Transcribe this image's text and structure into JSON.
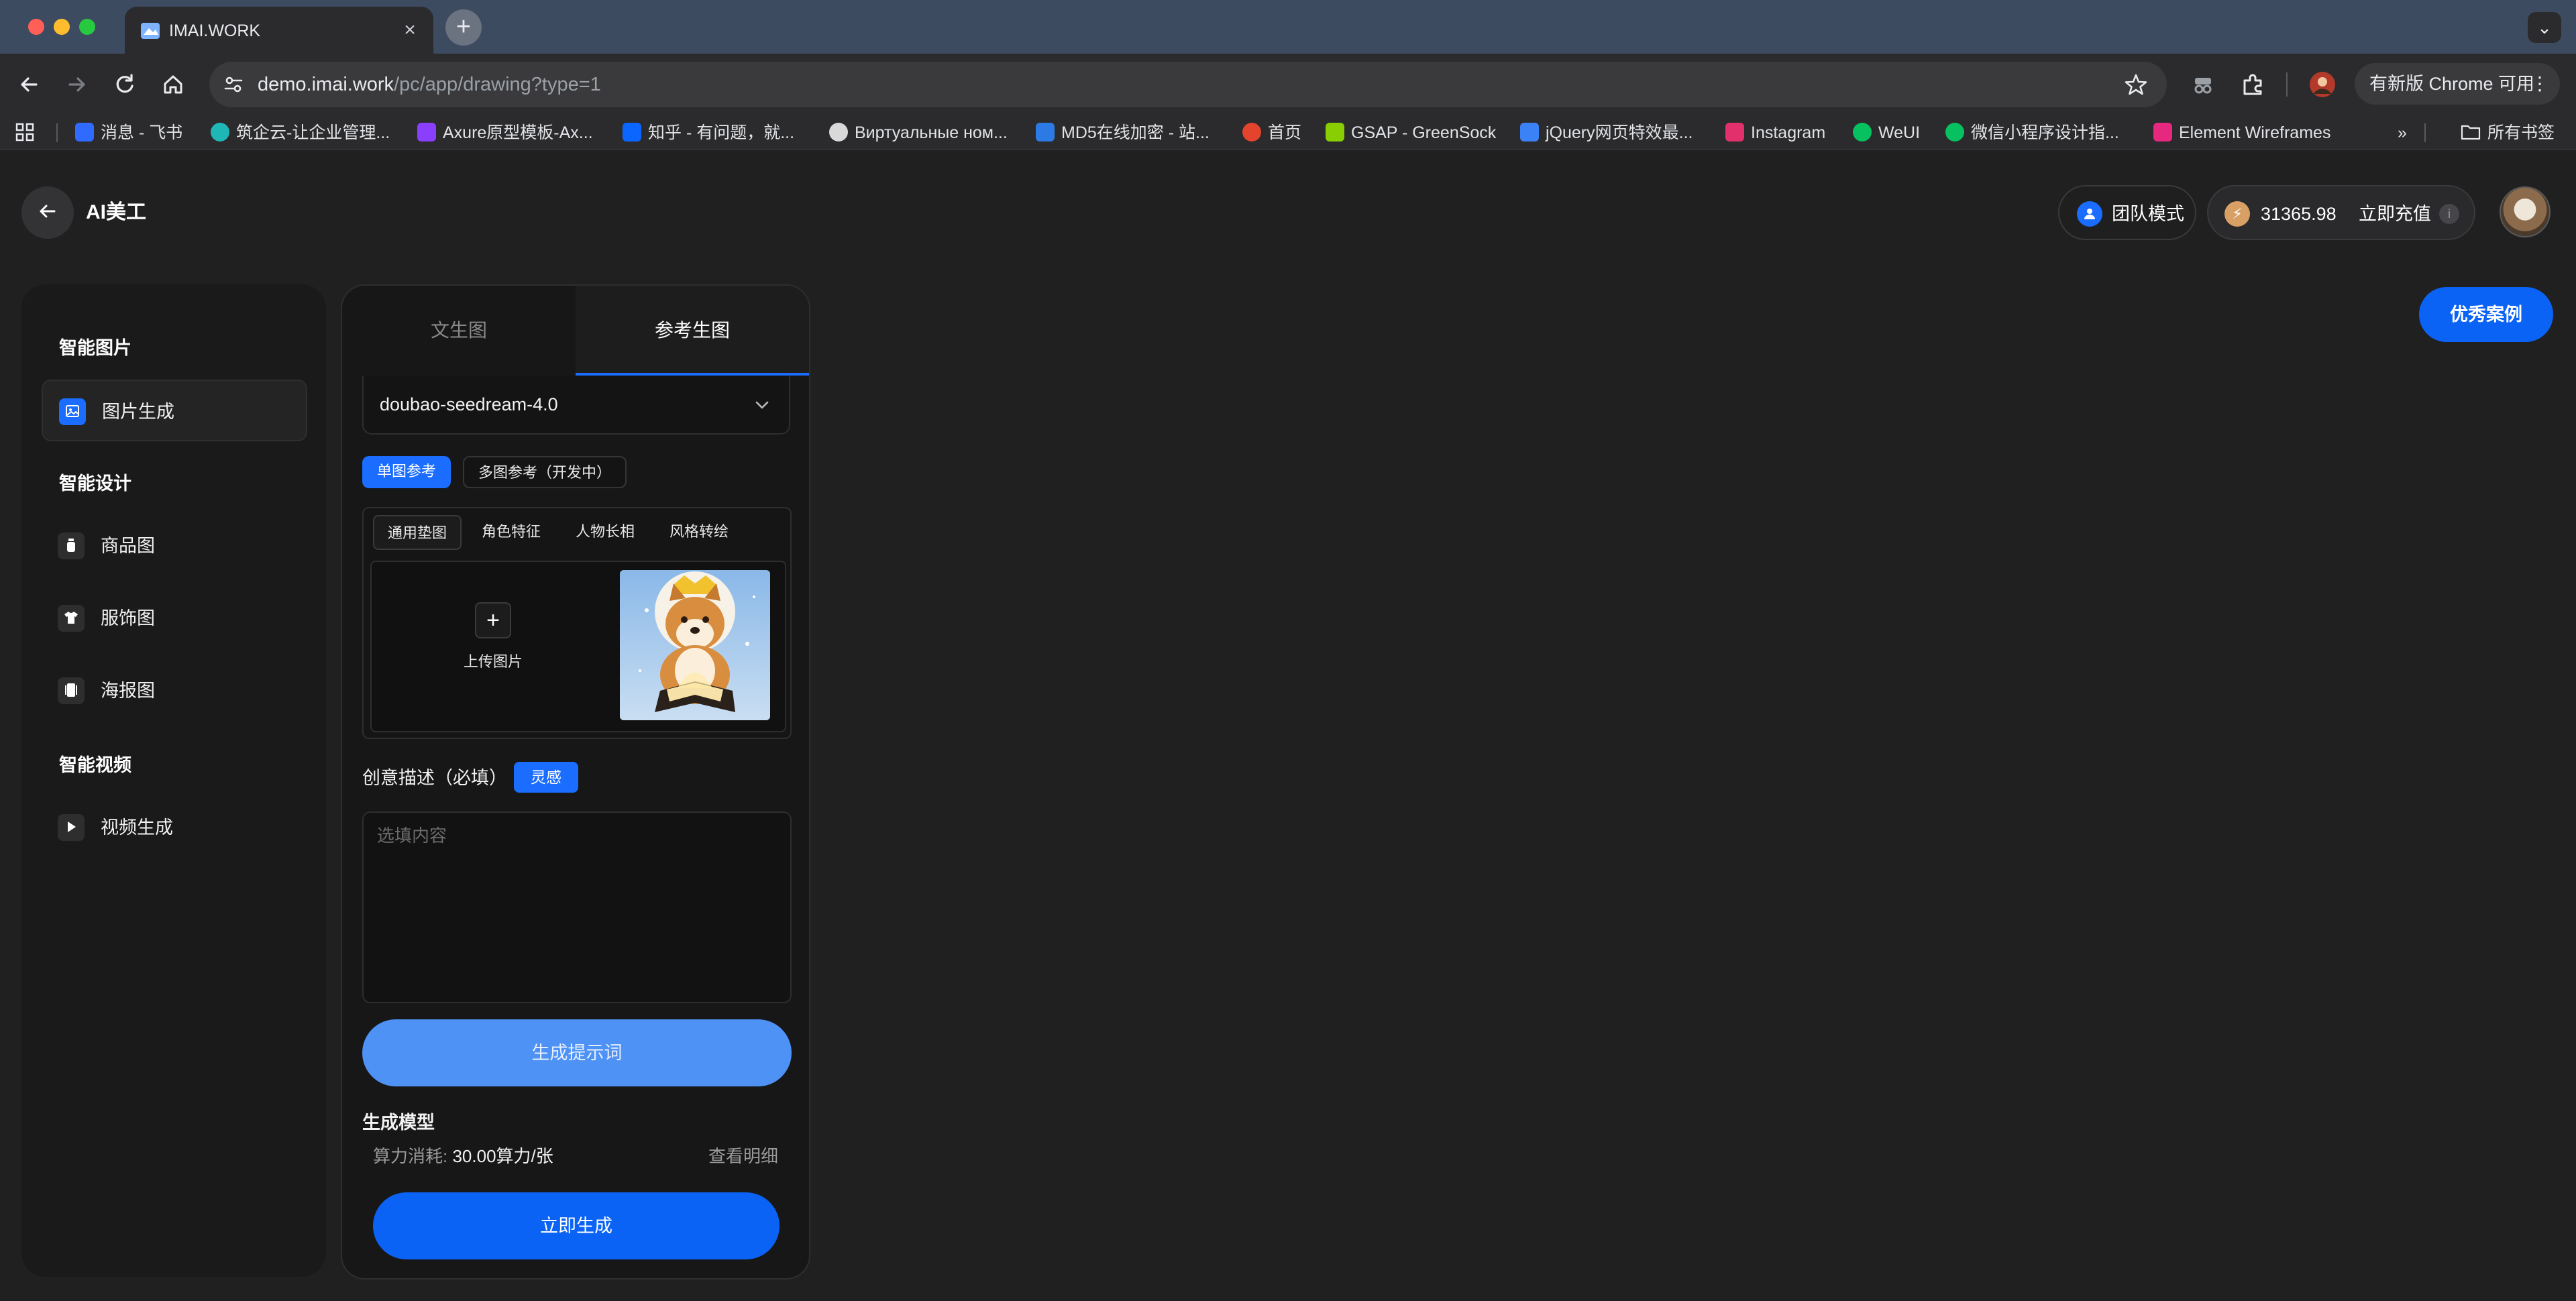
{
  "browser": {
    "tab_title": "IMAI.WORK",
    "url_host": "demo.imai.work",
    "url_path": "/pc/app/drawing?type=1",
    "update_label": "有新版 Chrome 可用",
    "bookmarks": [
      {
        "label": "消息 - 飞书",
        "color": "#2f6bff"
      },
      {
        "label": "筑企云-让企业管理...",
        "color": "#1fb6b6"
      },
      {
        "label": "Axure原型模板-Ax...",
        "color": "#8a3ffc"
      },
      {
        "label": "知乎 - 有问题，就...",
        "color": "#0a66ff"
      },
      {
        "label": "Виртуальные ном...",
        "color": "#d9d9d9"
      },
      {
        "label": "MD5在线加密 - 站...",
        "color": "#2c7be5"
      },
      {
        "label": "首页",
        "color": "#e4442d"
      },
      {
        "label": "GSAP - GreenSock",
        "color": "#88ce02"
      },
      {
        "label": "jQuery网页特效最...",
        "color": "#3b82f6"
      },
      {
        "label": "Instagram",
        "color": "#e1306c"
      },
      {
        "label": "WeUI",
        "color": "#07c160"
      },
      {
        "label": "微信小程序设计指...",
        "color": "#07c160"
      },
      {
        "label": "Element Wireframes",
        "color": "#e6287f"
      }
    ],
    "all_bookmarks_label": "所有书签"
  },
  "header": {
    "title": "AI美工",
    "team_mode_label": "团队模式",
    "balance": "31365.98",
    "recharge_label": "立即充值",
    "info_glyph": "i"
  },
  "sidebar": {
    "groups": [
      {
        "title": "智能图片",
        "items": [
          {
            "label": "图片生成",
            "icon": "image-icon",
            "active": true
          }
        ]
      },
      {
        "title": "智能设计",
        "items": [
          {
            "label": "商品图",
            "icon": "product-icon",
            "active": false
          },
          {
            "label": "服饰图",
            "icon": "shirt-icon",
            "active": false
          },
          {
            "label": "海报图",
            "icon": "poster-icon",
            "active": false
          }
        ]
      },
      {
        "title": "智能视频",
        "items": [
          {
            "label": "视频生成",
            "icon": "play-icon",
            "active": false
          }
        ]
      }
    ]
  },
  "panel": {
    "tabs": [
      {
        "label": "文生图",
        "active": false
      },
      {
        "label": "参考生图",
        "active": true
      }
    ],
    "model_value": "doubao-seedream-4.0",
    "ref_modes": [
      {
        "label": "单图参考",
        "active": true
      },
      {
        "label": "多图参考（开发中）",
        "active": false
      }
    ],
    "sub_tabs": [
      {
        "label": "通用垫图",
        "active": true
      },
      {
        "label": "角色特征",
        "active": false
      },
      {
        "label": "人物长相",
        "active": false
      },
      {
        "label": "风格转绘",
        "active": false
      }
    ],
    "upload_label": "上传图片",
    "description_label": "创意描述（必填）",
    "inspiration_label": "灵感",
    "description_placeholder": "选填内容",
    "generate_prompt_label": "生成提示词",
    "gen_model_label": "生成模型",
    "cost_label": "算力消耗:",
    "cost_value": "30.00算力/张",
    "detail_label": "查看明细",
    "generate_label": "立即生成"
  },
  "cases_label": "优秀案例",
  "colors": {
    "accent": "#0b63f6",
    "accent_light": "#4e92f6",
    "background": "#202020"
  }
}
